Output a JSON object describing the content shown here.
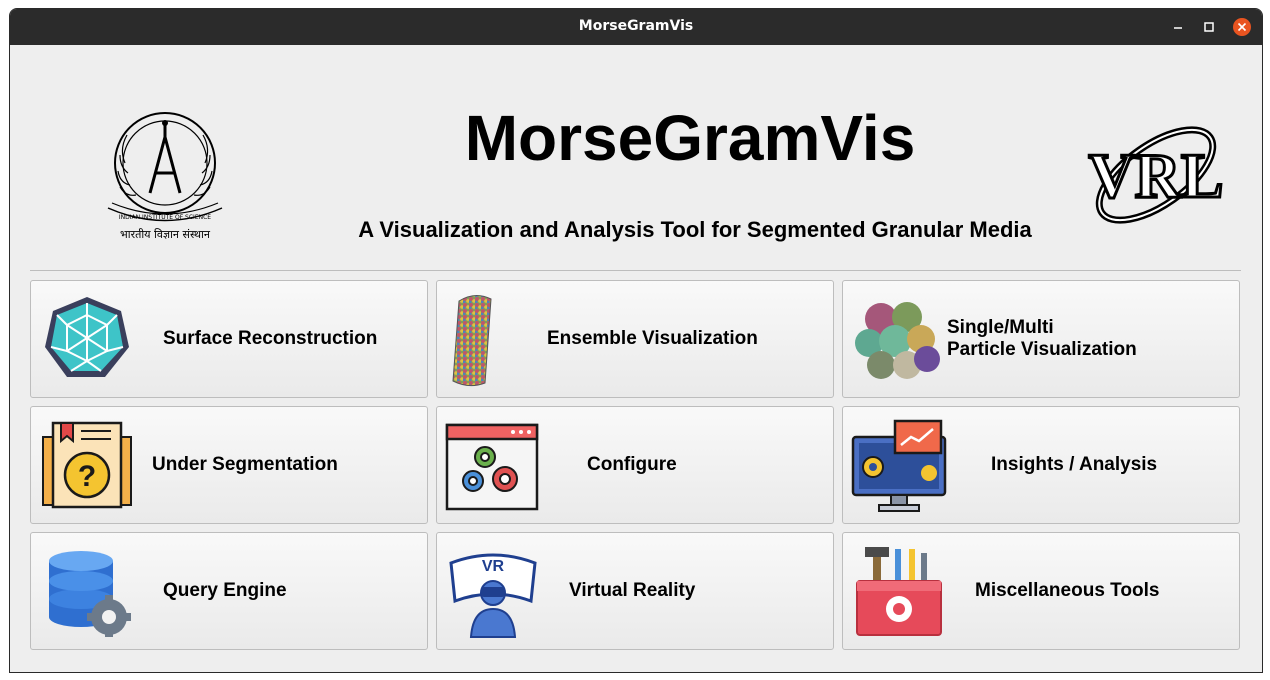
{
  "window": {
    "title": "MorseGramVis"
  },
  "header": {
    "title": "MorseGramVis",
    "subtitle": "A Visualization and Analysis Tool for Segmented Granular Media",
    "left_logo": {
      "name": "iisc-logo",
      "arc_text": "INDIAN INSTITUTE OF SCIENCE",
      "hindi_text": "भारतीय विज्ञान संस्थान"
    },
    "right_logo": {
      "name": "vrl-logo",
      "text": "VRL"
    }
  },
  "tiles": [
    {
      "label_lines": [
        "Surface Reconstruction"
      ],
      "icon": "polyhedron-mesh-icon"
    },
    {
      "label_lines": [
        "Ensemble Visualization"
      ],
      "icon": "particle-cylinder-icon"
    },
    {
      "label_lines": [
        "Single/Multi",
        "Particle Visualization"
      ],
      "icon": "particle-cluster-icon"
    },
    {
      "label_lines": [
        "Under Segmentation"
      ],
      "icon": "question-document-icon"
    },
    {
      "label_lines": [
        "Configure"
      ],
      "icon": "gears-window-icon"
    },
    {
      "label_lines": [
        "Insights / Analysis"
      ],
      "icon": "analytics-monitor-icon"
    },
    {
      "label_lines": [
        "Query Engine"
      ],
      "icon": "database-gear-icon"
    },
    {
      "label_lines": [
        "Virtual Reality"
      ],
      "icon": "vr-headset-icon"
    },
    {
      "label_lines": [
        "Miscellaneous Tools"
      ],
      "icon": "toolbox-icon"
    }
  ],
  "colors": {
    "titlebar": "#2b2b2b",
    "close_button": "#e95420",
    "background": "#eeeeee"
  }
}
